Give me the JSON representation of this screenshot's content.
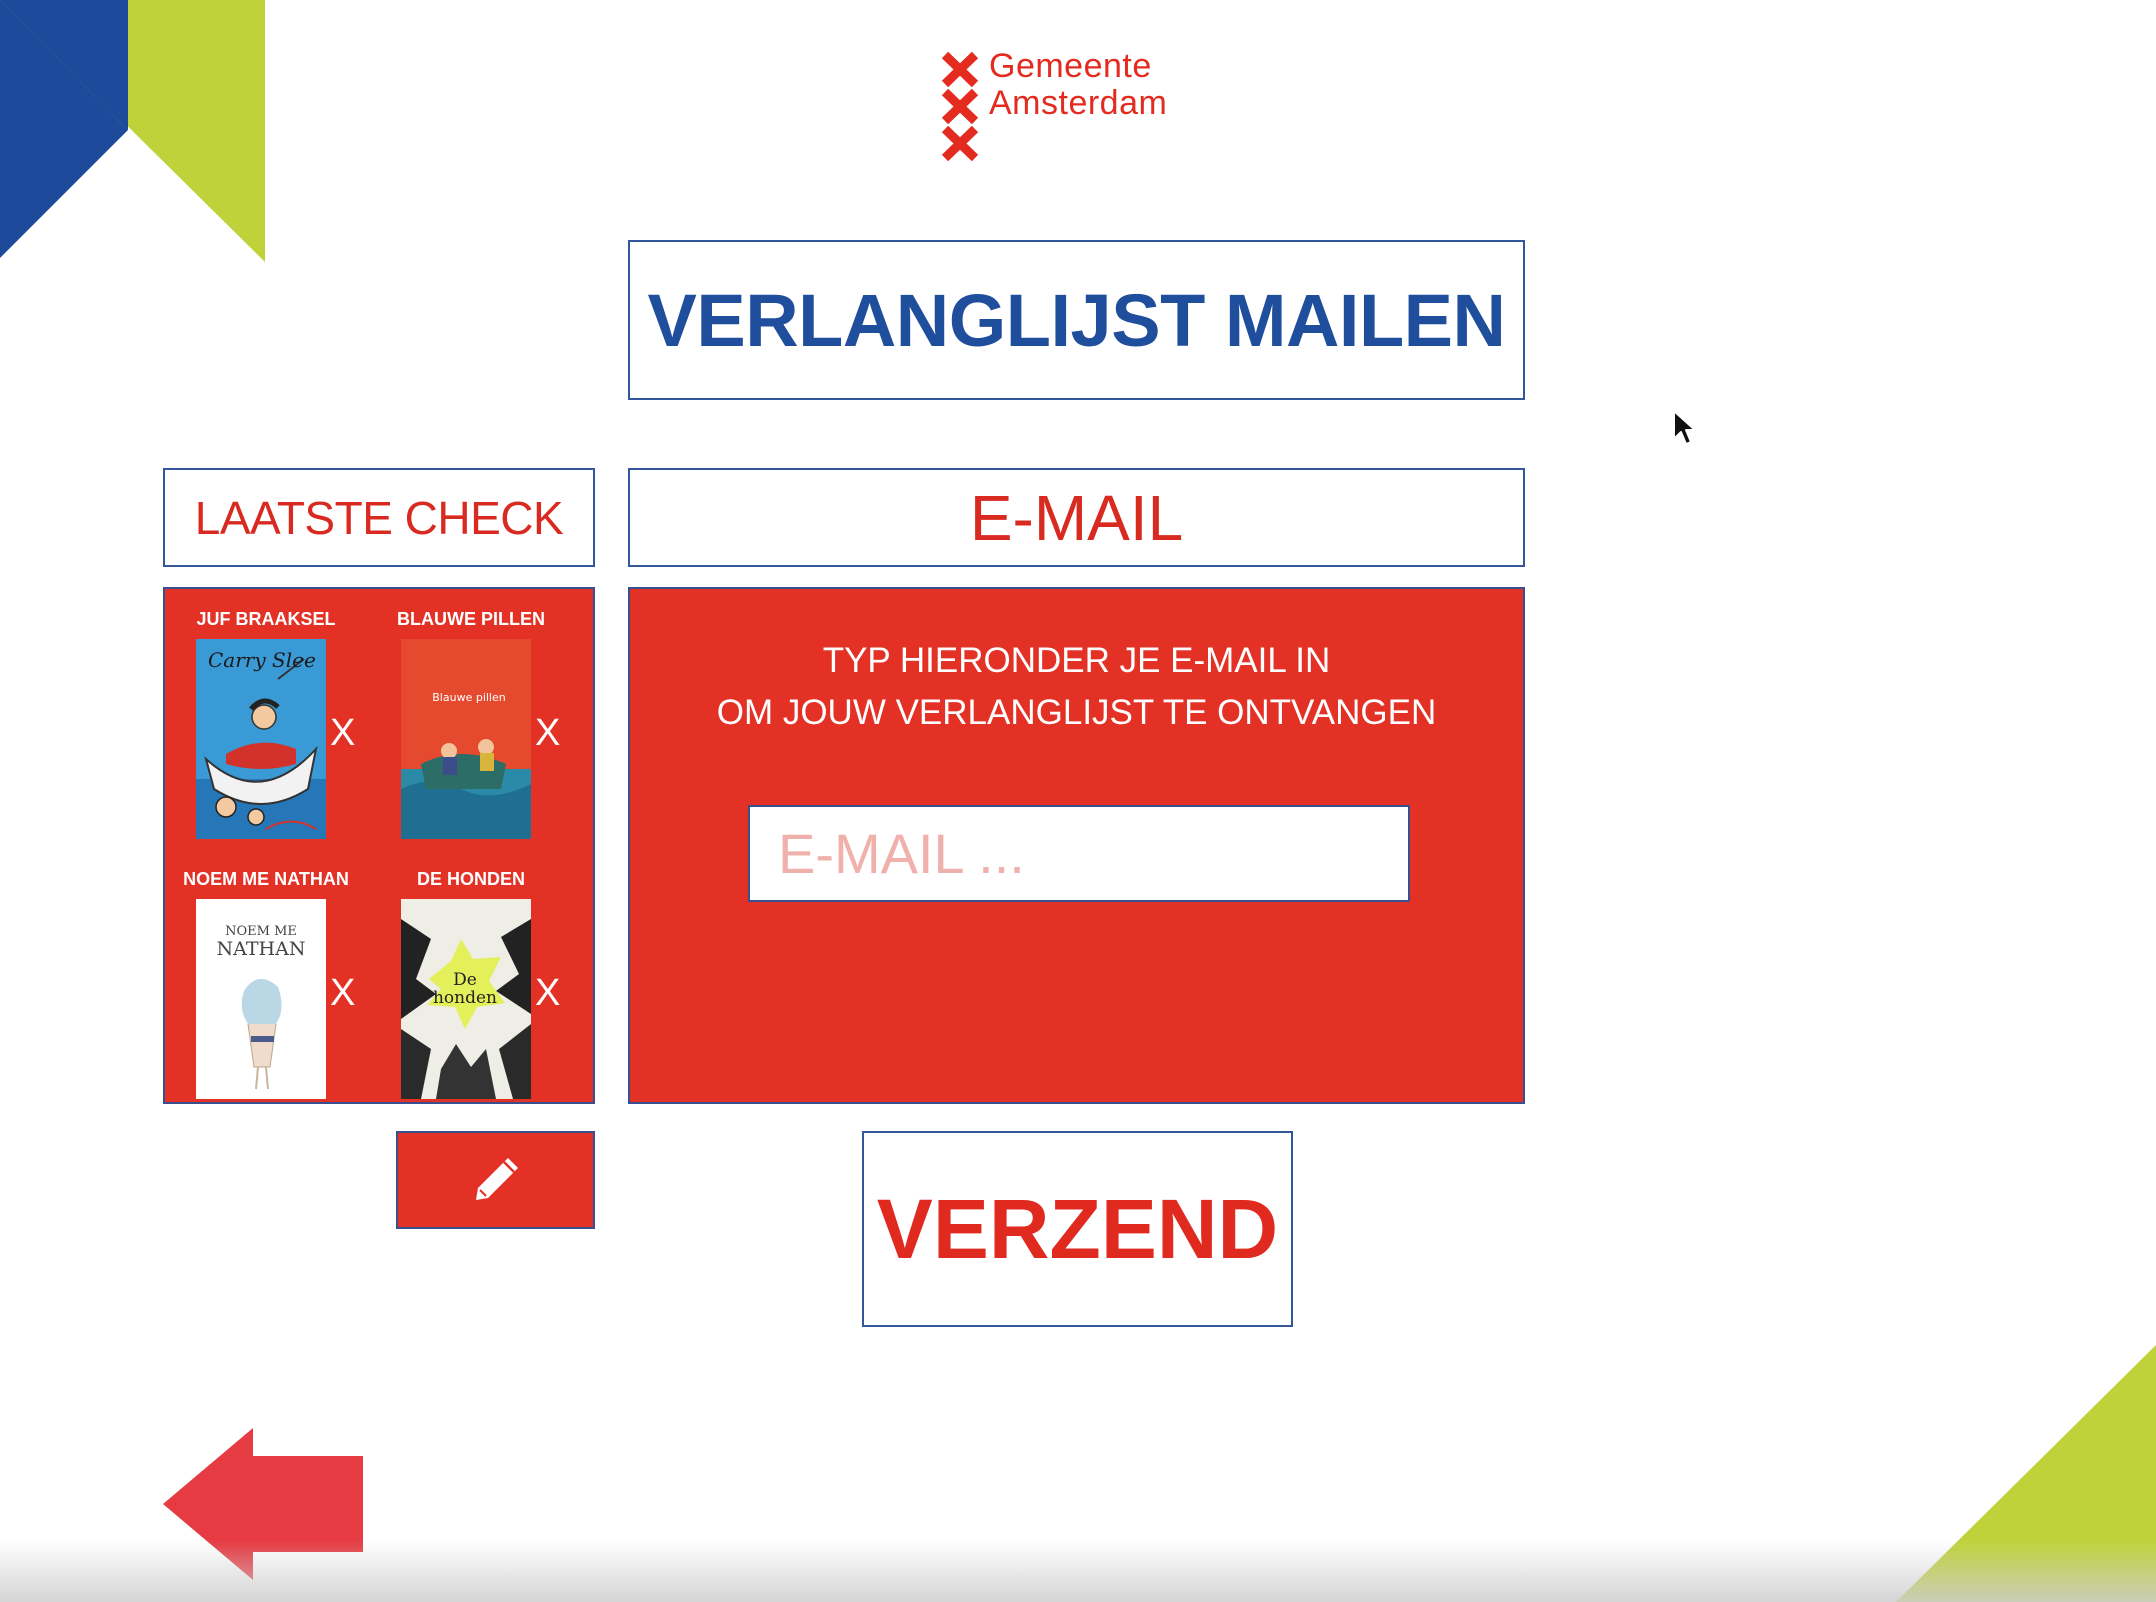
{
  "logo": {
    "line1": "Gemeente",
    "line2": "Amsterdam",
    "icon": "amsterdam-triple-x-icon"
  },
  "title": "VERLANGLIJST MAILEN",
  "check": {
    "heading": "LAATSTE CHECK",
    "books": [
      {
        "title": "JUF BRAAKSEL",
        "remove_label": "X",
        "cover_author": "Carry Slee",
        "cover_color": "#2b8fd0"
      },
      {
        "title": "BLAUWE PILLEN",
        "remove_label": "X",
        "cover_text": "Blauwe pillen",
        "cover_color": "#e64a2e"
      },
      {
        "title": "NOEM ME NATHAN",
        "remove_label": "X",
        "cover_line1": "NOEM ME",
        "cover_line2": "NATHAN",
        "cover_color": "#ffffff"
      },
      {
        "title": "DE HONDEN",
        "remove_label": "X",
        "cover_line1": "De",
        "cover_line2": "honden",
        "cover_color": "#e9e9e0"
      }
    ],
    "edit_icon": "pencil-icon"
  },
  "email": {
    "heading": "E-MAIL",
    "instruction_line1": "TYP HIERONDER JE E-MAIL IN",
    "instruction_line2": "OM JOUW VERLANGLIJST TE ONTVANGEN",
    "placeholder": "E-MAIL ...",
    "value": ""
  },
  "send_label": "VERZEND",
  "back_icon": "arrow-left-icon",
  "colors": {
    "brand_red": "#e43126",
    "brand_blue": "#1f4e9c",
    "frame_border": "#34569b",
    "corner_lime": "#bfd23a",
    "corner_blue": "#1e4a9c"
  }
}
